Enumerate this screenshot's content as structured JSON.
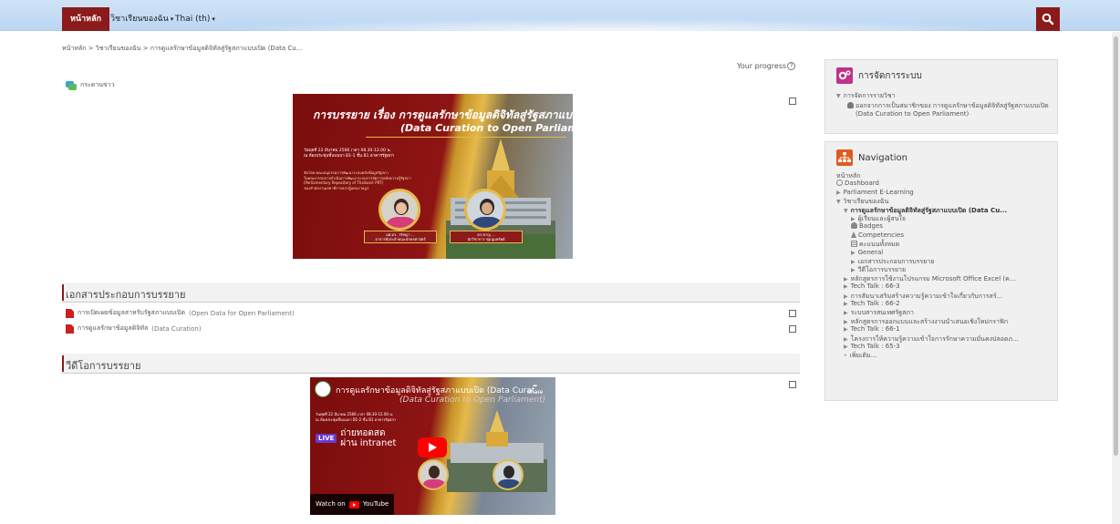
{
  "navbar": {
    "home": "หน้าหลัก",
    "my_courses": "วิชาเรียนของฉัน",
    "language": "Thai (th)"
  },
  "breadcrumb": "หน้าหลัก > วิชาเรียนของฉัน > การดูแลรักษาข้อมูลดิจิทัลสู่รัฐสภาแบบเปิด (Data Cu...",
  "progress_label": "Your progress",
  "news": "กระดานข่าว",
  "banner": {
    "title1": "การบรรยาย เรื่อง การดูแลรักษาข้อมูลดิจิทัลสู่รัฐสภาแบบเปิด",
    "title2": "(Data Curation to Open Parliament)",
    "info": [
      "วันพุธที่ 22 มีนาคม 2566 เวลา 08.30-12.00 น.",
      "ณ ห้องประชุมชั้นบนบา B1-1 ชั้น B1 อาคารรัฐสภา"
    ],
    "info2": [
      "จัดโดย คณะอนุกรรมการพัฒนาระบบคลังข้อมูลรัฐสภา",
      "ในคณะกรรมการดำเนินการพัฒนาระบบการจัดการคลังความรู้รัฐสภา",
      "(Parliamentary Repository of Thailand: PRT)",
      "ของสำนักงานเลขาธิการสภาผู้แทนราษฎร"
    ],
    "speaker1": [
      "ผศ.ดร. วรัชญา ... ",
      "อาจารย์ประจำคณะอักษรศาสตร์"
    ],
    "speaker2": [
      "ดร.ชาญ ... ",
      "นักวิชาการ ชุมนุมทรัพย์"
    ]
  },
  "section1": {
    "title": "เอกสารประกอบการบรรยาย",
    "items": [
      {
        "label": "การเปิดเผยข้อมูลสาหรับรัฐสภาแบบเปิด",
        "suffix": "(Open Data for Open Parliament)"
      },
      {
        "label": "การดูแลรักษาข้อมูลดิจิทัล",
        "suffix": "(Data Curation)"
      }
    ]
  },
  "section2": {
    "title": "วีดีโอการบรรยาย"
  },
  "video": {
    "title": "การดูแลรักษาข้อมูลดิจิทัลสู่รัฐสภาแบบเปิด (Data Curat...",
    "subtitle": "(Data Curation to Open Parliament)",
    "share": "Share",
    "info": [
      "วันพุธที่ 22 มีนาคม 2566 เวลา 08.30-12.00 น.",
      "ณ ห้องประชุมชั้นบนบา B1-2 ชั้น B1 อาคารรัฐสภา"
    ],
    "live_badge": "LIVE",
    "live_text1": "ถ่ายทอดสด",
    "live_text2": "ผ่าน intranet",
    "watch_on": "Watch on",
    "youtube": "YouTube"
  },
  "admin_block": {
    "title": "การจัดการระบบ",
    "course_admin": "การจัดการรายวิชา",
    "unenrol": "ออกจากการเป็นสมาชิกของ การดูแลรักษาข้อมูลดิจิทัลสู่รัฐสภาแบบเปิด",
    "unenrol2": "(Data Curation to Open Parliament)"
  },
  "nav_block": {
    "title": "Navigation",
    "items": [
      {
        "label": "หน้าหลัก",
        "indent": 0,
        "marker": ""
      },
      {
        "label": "Dashboard",
        "indent": 0,
        "marker": "dash"
      },
      {
        "label": "Parliament E-Learning",
        "indent": 0,
        "marker": "▶"
      },
      {
        "label": "วิชาเรียนของฉัน",
        "indent": 0,
        "marker": "▼"
      },
      {
        "label": "การดูแลรักษาข้อมูลดิจิทัลสู่รัฐสภาแบบเปิด (Data Cu...",
        "indent": 1,
        "marker": "▼",
        "bold": true
      },
      {
        "label": "ผู้เรียนและผู้สนใจ",
        "indent": 2,
        "marker": "▶"
      },
      {
        "label": "Badges",
        "indent": 2,
        "marker": "badge"
      },
      {
        "label": "Competencies",
        "indent": 2,
        "marker": "comp"
      },
      {
        "label": "คะแนนทั้งหมด",
        "indent": 2,
        "marker": "grade"
      },
      {
        "label": "General",
        "indent": 2,
        "marker": "▶"
      },
      {
        "label": "เอกสารประกอบการบรรยาย",
        "indent": 2,
        "marker": "▶"
      },
      {
        "label": "วีดีโอการบรรยาย",
        "indent": 2,
        "marker": "▶"
      },
      {
        "label": "หลักสูตรการใช้งานโปรแกรม Microsoft Office Excel (ค...",
        "indent": 1,
        "marker": "▶"
      },
      {
        "label": "Tech Talk : 66-3",
        "indent": 1,
        "marker": "▶"
      },
      {
        "label": "การสัมนาเสริมสร้างความรู้ความเข้าใจเกี่ยวกับการสร์...",
        "indent": 1,
        "marker": "▶"
      },
      {
        "label": "Tech Talk : 66-2",
        "indent": 1,
        "marker": "▶"
      },
      {
        "label": "ระบบสารสนเทศรัฐสภา",
        "indent": 1,
        "marker": "▶"
      },
      {
        "label": "หลักสูตรการออกแบบและสร้างงานนำเสนอเชิงใหม่กราฟิก",
        "indent": 1,
        "marker": "▶"
      },
      {
        "label": "Tech Talk : 66-1",
        "indent": 1,
        "marker": "▶"
      },
      {
        "label": "โครงการให้ความรู้ความเข้าใจการรักษาความมั่นคงปลอดภ...",
        "indent": 1,
        "marker": "▶"
      },
      {
        "label": "Tech Talk : 65-3",
        "indent": 1,
        "marker": "▶"
      },
      {
        "label": "เพิ่มเติม...",
        "indent": 1,
        "marker": "•"
      }
    ]
  },
  "colors": {
    "brand": "#8b1a1a",
    "topbar": "#c6ddf5",
    "gold": "#e6b94a",
    "block_bg": "#f0f0f0",
    "admin_icon": "#c0328c",
    "nav_icon": "#e05a1e"
  }
}
